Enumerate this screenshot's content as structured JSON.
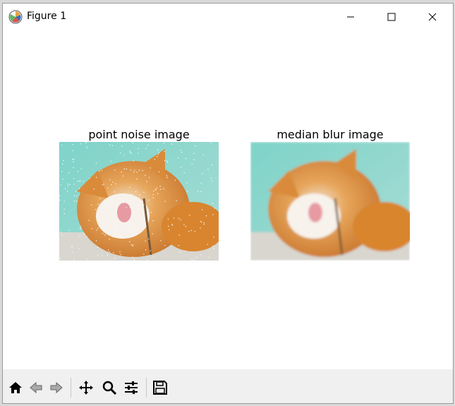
{
  "window": {
    "title": "Figure 1"
  },
  "figure": {
    "subplots": [
      {
        "title": "point noise image"
      },
      {
        "title": "median blur image"
      }
    ]
  },
  "toolbar": {
    "buttons": [
      "home-icon",
      "back-icon",
      "forward-icon",
      "pan-icon",
      "zoom-icon",
      "configure-subplots-icon",
      "save-icon"
    ]
  }
}
